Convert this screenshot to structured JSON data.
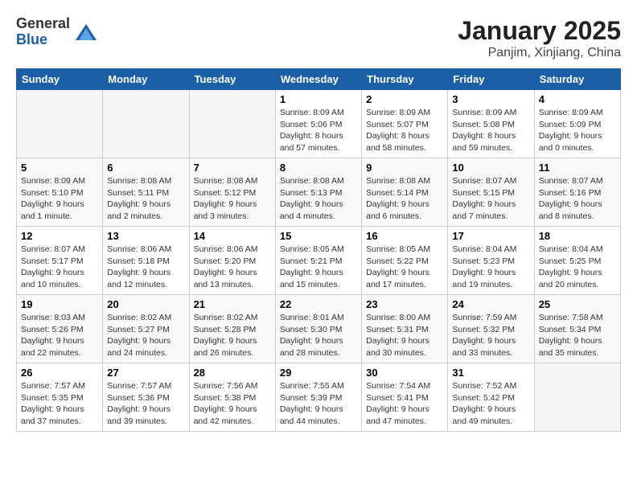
{
  "logo": {
    "general": "General",
    "blue": "Blue"
  },
  "title": "January 2025",
  "location": "Panjim, Xinjiang, China",
  "days_of_week": [
    "Sunday",
    "Monday",
    "Tuesday",
    "Wednesday",
    "Thursday",
    "Friday",
    "Saturday"
  ],
  "weeks": [
    [
      {
        "day": "",
        "info": ""
      },
      {
        "day": "",
        "info": ""
      },
      {
        "day": "",
        "info": ""
      },
      {
        "day": "1",
        "info": "Sunrise: 8:09 AM\nSunset: 5:06 PM\nDaylight: 8 hours and 57 minutes."
      },
      {
        "day": "2",
        "info": "Sunrise: 8:09 AM\nSunset: 5:07 PM\nDaylight: 8 hours and 58 minutes."
      },
      {
        "day": "3",
        "info": "Sunrise: 8:09 AM\nSunset: 5:08 PM\nDaylight: 8 hours and 59 minutes."
      },
      {
        "day": "4",
        "info": "Sunrise: 8:09 AM\nSunset: 5:09 PM\nDaylight: 9 hours and 0 minutes."
      }
    ],
    [
      {
        "day": "5",
        "info": "Sunrise: 8:09 AM\nSunset: 5:10 PM\nDaylight: 9 hours and 1 minute."
      },
      {
        "day": "6",
        "info": "Sunrise: 8:08 AM\nSunset: 5:11 PM\nDaylight: 9 hours and 2 minutes."
      },
      {
        "day": "7",
        "info": "Sunrise: 8:08 AM\nSunset: 5:12 PM\nDaylight: 9 hours and 3 minutes."
      },
      {
        "day": "8",
        "info": "Sunrise: 8:08 AM\nSunset: 5:13 PM\nDaylight: 9 hours and 4 minutes."
      },
      {
        "day": "9",
        "info": "Sunrise: 8:08 AM\nSunset: 5:14 PM\nDaylight: 9 hours and 6 minutes."
      },
      {
        "day": "10",
        "info": "Sunrise: 8:07 AM\nSunset: 5:15 PM\nDaylight: 9 hours and 7 minutes."
      },
      {
        "day": "11",
        "info": "Sunrise: 8:07 AM\nSunset: 5:16 PM\nDaylight: 9 hours and 8 minutes."
      }
    ],
    [
      {
        "day": "12",
        "info": "Sunrise: 8:07 AM\nSunset: 5:17 PM\nDaylight: 9 hours and 10 minutes."
      },
      {
        "day": "13",
        "info": "Sunrise: 8:06 AM\nSunset: 5:18 PM\nDaylight: 9 hours and 12 minutes."
      },
      {
        "day": "14",
        "info": "Sunrise: 8:06 AM\nSunset: 5:20 PM\nDaylight: 9 hours and 13 minutes."
      },
      {
        "day": "15",
        "info": "Sunrise: 8:05 AM\nSunset: 5:21 PM\nDaylight: 9 hours and 15 minutes."
      },
      {
        "day": "16",
        "info": "Sunrise: 8:05 AM\nSunset: 5:22 PM\nDaylight: 9 hours and 17 minutes."
      },
      {
        "day": "17",
        "info": "Sunrise: 8:04 AM\nSunset: 5:23 PM\nDaylight: 9 hours and 19 minutes."
      },
      {
        "day": "18",
        "info": "Sunrise: 8:04 AM\nSunset: 5:25 PM\nDaylight: 9 hours and 20 minutes."
      }
    ],
    [
      {
        "day": "19",
        "info": "Sunrise: 8:03 AM\nSunset: 5:26 PM\nDaylight: 9 hours and 22 minutes."
      },
      {
        "day": "20",
        "info": "Sunrise: 8:02 AM\nSunset: 5:27 PM\nDaylight: 9 hours and 24 minutes."
      },
      {
        "day": "21",
        "info": "Sunrise: 8:02 AM\nSunset: 5:28 PM\nDaylight: 9 hours and 26 minutes."
      },
      {
        "day": "22",
        "info": "Sunrise: 8:01 AM\nSunset: 5:30 PM\nDaylight: 9 hours and 28 minutes."
      },
      {
        "day": "23",
        "info": "Sunrise: 8:00 AM\nSunset: 5:31 PM\nDaylight: 9 hours and 30 minutes."
      },
      {
        "day": "24",
        "info": "Sunrise: 7:59 AM\nSunset: 5:32 PM\nDaylight: 9 hours and 33 minutes."
      },
      {
        "day": "25",
        "info": "Sunrise: 7:58 AM\nSunset: 5:34 PM\nDaylight: 9 hours and 35 minutes."
      }
    ],
    [
      {
        "day": "26",
        "info": "Sunrise: 7:57 AM\nSunset: 5:35 PM\nDaylight: 9 hours and 37 minutes."
      },
      {
        "day": "27",
        "info": "Sunrise: 7:57 AM\nSunset: 5:36 PM\nDaylight: 9 hours and 39 minutes."
      },
      {
        "day": "28",
        "info": "Sunrise: 7:56 AM\nSunset: 5:38 PM\nDaylight: 9 hours and 42 minutes."
      },
      {
        "day": "29",
        "info": "Sunrise: 7:55 AM\nSunset: 5:39 PM\nDaylight: 9 hours and 44 minutes."
      },
      {
        "day": "30",
        "info": "Sunrise: 7:54 AM\nSunset: 5:41 PM\nDaylight: 9 hours and 47 minutes."
      },
      {
        "day": "31",
        "info": "Sunrise: 7:52 AM\nSunset: 5:42 PM\nDaylight: 9 hours and 49 minutes."
      },
      {
        "day": "",
        "info": ""
      }
    ]
  ]
}
